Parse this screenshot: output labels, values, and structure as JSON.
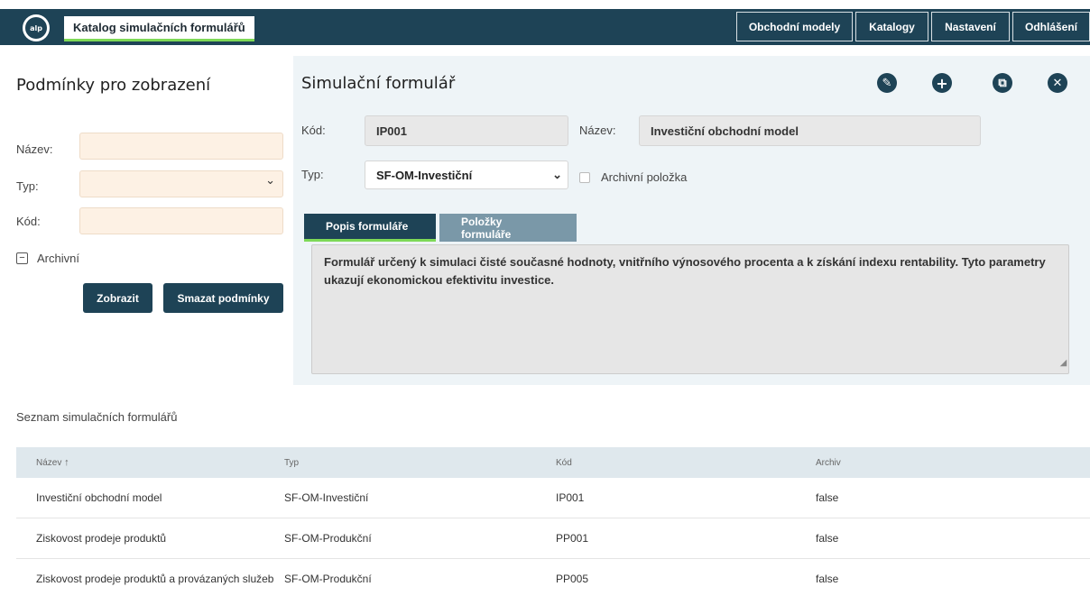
{
  "header": {
    "logo_text": "alp",
    "app_title": "Katalog simulačních formulářů",
    "nav": [
      "Obchodní modely",
      "Katalogy",
      "Nastavení",
      "Odhlášení"
    ]
  },
  "filter": {
    "title": "Podmínky pro zobrazení",
    "name_label": "Název:",
    "type_label": "Typ:",
    "code_label": "Kód:",
    "name_value": "",
    "type_value": "",
    "code_value": "",
    "archive_label": "Archivní",
    "show_button": "Zobrazit",
    "clear_button": "Smazat podmínky"
  },
  "form": {
    "title": "Simulační formulář",
    "code_label": "Kód:",
    "code_value": "IP001",
    "name_label": "Název:",
    "name_value": "Investiční obchodní model",
    "type_label": "Typ:",
    "type_value": "SF-OM-Investiční",
    "archive_label": "Archivní položka",
    "tabs": [
      "Popis formuláře",
      "Položky formuláře"
    ],
    "description": "Formulář určený k simulaci čisté současné hodnoty, vnitřního výnosového procenta a k získání indexu rentability. Tyto parametry ukazují ekonomickou  efektivitu investice."
  },
  "list": {
    "title": "Seznam simulačních formulářů",
    "columns": [
      "Název",
      "Typ",
      "Kód",
      "Archiv"
    ],
    "rows": [
      [
        "Investiční obchodní model",
        "SF-OM-Investiční",
        "IP001",
        "false"
      ],
      [
        "Ziskovost prodeje produktů",
        "SF-OM-Produkční",
        "PP001",
        "false"
      ],
      [
        "Ziskovost prodeje produktů a provázaných služeb",
        "SF-OM-Produkční",
        "PP005",
        "false"
      ]
    ]
  }
}
